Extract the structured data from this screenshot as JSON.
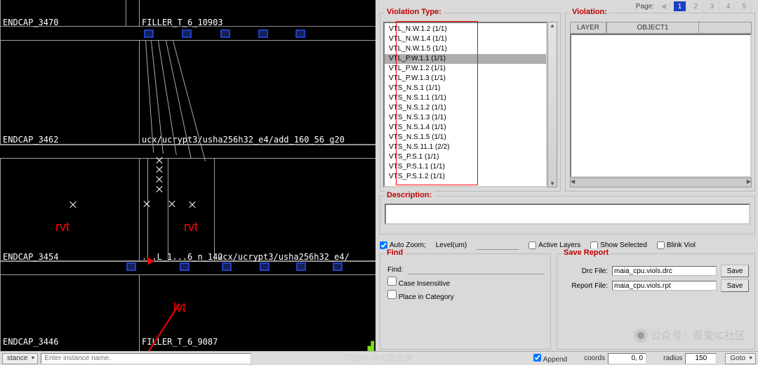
{
  "pager": {
    "label": "Page:",
    "pages": [
      "1",
      "2",
      "3",
      "4",
      "5"
    ],
    "active": 0
  },
  "panels": {
    "violation_type": "Violation Type:",
    "violation": "Violation:",
    "description": "Description:",
    "find": "Find",
    "save": "Save Report"
  },
  "violation_headers": {
    "layer": "LAYER",
    "object1": "OBJECT1"
  },
  "violation_type_list": [
    "VTL_N.W.1.2 (1/1)",
    "VTL_N.W.1.4 (1/1)",
    "VTL_N.W.1.5 (1/1)",
    "VTL_P.W.1.1 (1/1)",
    "VTL_P.W.1.2 (1/1)",
    "VTL_P.W.1.3 (1/1)",
    "VTS_N.S.1 (1/1)",
    "VTS_N.S.1.1 (1/1)",
    "VTS_N.S.1.2 (1/1)",
    "VTS_N.S.1.3 (1/1)",
    "VTS_N.S.1.4 (1/1)",
    "VTS_N.S.1.5 (1/1)",
    "VTS_N.S.11.1 (2/2)",
    "VTS_P.S.1 (1/1)",
    "VTS_P.S.1.1 (1/1)",
    "VTS_P.S.1.2 (1/1)"
  ],
  "violation_selected_index": 3,
  "options": {
    "auto_zoom": {
      "label": "Auto Zoom;",
      "checked": true
    },
    "level": "Level(um)",
    "active_layers": {
      "label": "Active Layers",
      "checked": false
    },
    "show_selected": {
      "label": "Show Selected",
      "checked": false
    },
    "blink_viol": {
      "label": "Blink Viol",
      "checked": false
    }
  },
  "find": {
    "find_label": "Find:",
    "case_ins": {
      "label": "Case Insensitive",
      "checked": false
    },
    "place_cat": {
      "label": "Place in Category",
      "checked": false
    }
  },
  "save": {
    "drc_label": "Drc File:",
    "drc_value": "maia_cpu.viols.drc",
    "rpt_label": "Report File:",
    "rpt_value": "maia_cpu.viols.rpt",
    "save_btn": "Save"
  },
  "layout": {
    "cells": {
      "endcap_3470": "ENDCAP_3470",
      "filler_10903": "FILLER_T_6_10903",
      "endcap_3462": "ENDCAP_3462",
      "ucx1": "ucx/ucrypt3/usha256h32_e4/add_160_56_g20",
      "endcap_3454": "ENDCAP_3454",
      "mid": "...L_1...6_n_142",
      "ucx2": "ucx/ucrypt3/usha256h32_e4/",
      "endcap_3446": "ENDCAP_3446",
      "filler_9087": "FILLER_T_6_9087"
    },
    "anno": {
      "rvt1": "rvt",
      "rvt2": "rvt",
      "lvt": "lvt"
    }
  },
  "status": {
    "stance_label": "stance",
    "inst_placeholder": "Enter instance name.",
    "append": {
      "label": "Append",
      "checked": true
    },
    "coords_label": "coords",
    "coords_value": "0, 0",
    "radius_label": "radius",
    "radius_value": "150",
    "goto": "Goto"
  },
  "watermark": "公众号：吾爱IC社区",
  "csdn": "CSDN @IC拓荒者"
}
